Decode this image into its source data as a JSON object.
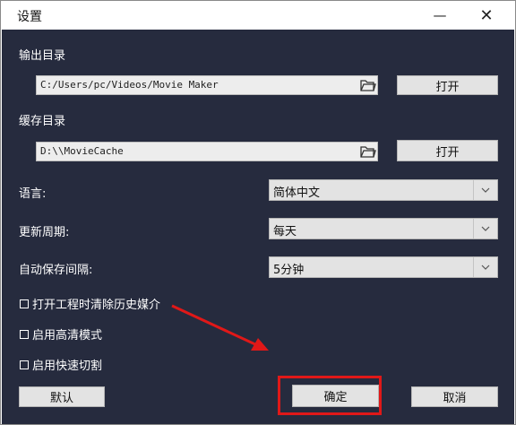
{
  "window": {
    "title": "设置"
  },
  "output_dir": {
    "label": "输出目录",
    "value": "C:/Users/pc/Videos/Movie Maker",
    "open_button": "打开"
  },
  "cache_dir": {
    "label": "缓存目录",
    "value": "D:\\\\MovieCache",
    "open_button": "打开"
  },
  "language": {
    "label": "语言:",
    "selected": "简体中文"
  },
  "update_period": {
    "label": "更新周期:",
    "selected": "每天"
  },
  "autosave_interval": {
    "label": "自动保存间隔:",
    "selected": "5分钟"
  },
  "checkboxes": [
    {
      "label": "打开工程时清除历史媒介",
      "checked": false
    },
    {
      "label": "启用高清模式",
      "checked": false
    },
    {
      "label": "启用快速切割",
      "checked": false
    }
  ],
  "buttons": {
    "default": "默认",
    "ok": "确定",
    "cancel": "取消"
  },
  "colors": {
    "panel_bg": "#262b3e",
    "highlight": "#e01818"
  }
}
